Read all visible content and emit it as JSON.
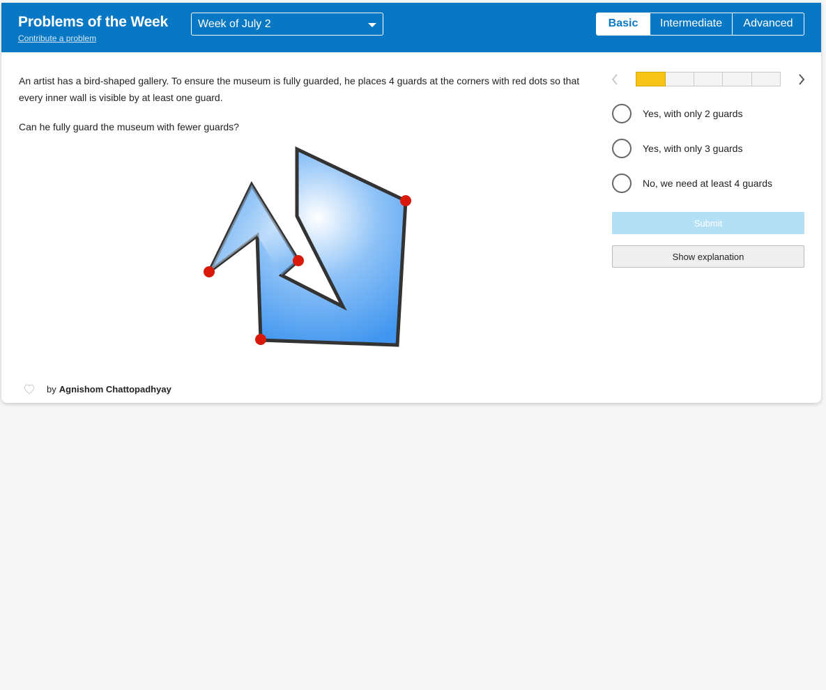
{
  "header": {
    "title": "Problems of the Week",
    "contribute_link": "Contribute a problem",
    "week_selector": {
      "selected": "Week of July 2"
    },
    "levels": [
      {
        "label": "Basic",
        "active": true
      },
      {
        "label": "Intermediate",
        "active": false
      },
      {
        "label": "Advanced",
        "active": false
      }
    ]
  },
  "problem": {
    "text": "An artist has a bird-shaped gallery. To ensure the museum is fully guarded, he places 4 guards at the corners with red dots so that every inner wall is visible by at least one guard.",
    "question": "Can he fully guard the museum with fewer guards?",
    "figure": {
      "fill_color": "#4a9cf0",
      "outline_color": "#333333",
      "guard_color": "#d8190c"
    }
  },
  "author": {
    "prefix": "by",
    "name": "Agnishom Chattopadhyay"
  },
  "sidebar": {
    "progress": {
      "segments": 5,
      "completed": 1
    },
    "options": [
      {
        "label": "Yes, with only 2 guards"
      },
      {
        "label": "Yes, with only 3 guards"
      },
      {
        "label": "No, we need at least 4 guards"
      }
    ],
    "submit_label": "Submit",
    "explanation_label": "Show explanation"
  },
  "colors": {
    "header": "#0878c4",
    "progress_fill": "#f7c518",
    "submit_disabled": "#b3e0f5"
  }
}
